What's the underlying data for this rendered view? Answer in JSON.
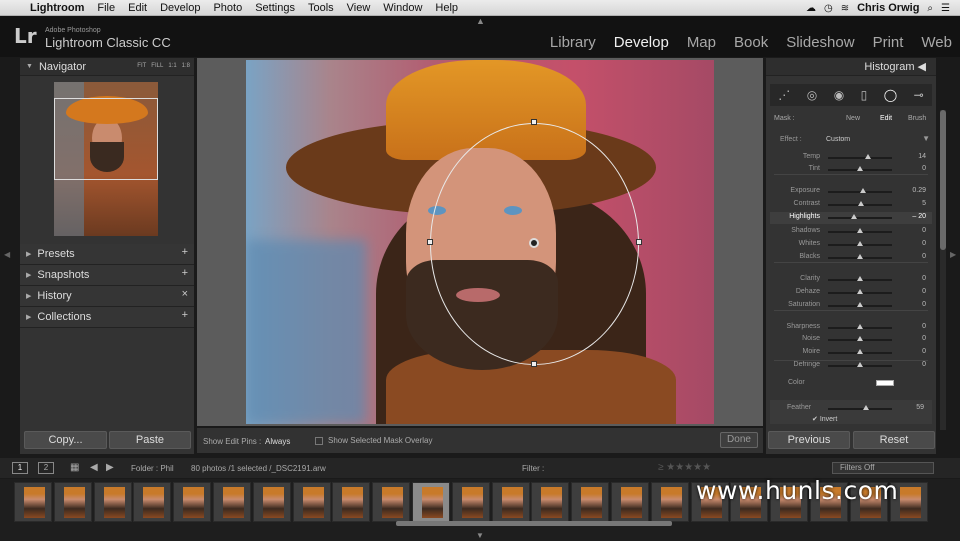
{
  "menubar": {
    "app": "Lightroom",
    "items": [
      "File",
      "Edit",
      "Develop",
      "Photo",
      "Settings",
      "Tools",
      "View",
      "Window",
      "Help"
    ],
    "user": "Chris Orwig"
  },
  "identity": {
    "logo": "Lr",
    "line1": "Adobe Photoshop",
    "line2": "Lightroom Classic CC"
  },
  "modules": {
    "library": "Library",
    "develop": "Develop",
    "map": "Map",
    "book": "Book",
    "slideshow": "Slideshow",
    "print": "Print",
    "web": "Web",
    "active": "Develop"
  },
  "left_panel": {
    "navigator": "Navigator",
    "zoom": {
      "fit": "FIT",
      "fill": "FILL",
      "one": "1:1",
      "ratio": "1:8"
    },
    "sections": [
      {
        "label": "Presets",
        "action": "+"
      },
      {
        "label": "Snapshots",
        "action": "+"
      },
      {
        "label": "History",
        "action": "×"
      },
      {
        "label": "Collections",
        "action": "+"
      }
    ],
    "copy": "Copy...",
    "paste": "Paste"
  },
  "toolbar": {
    "pins_label": "Show Edit Pins :",
    "pins_value": "Always",
    "overlay_label": "Show Selected Mask Overlay",
    "done": "Done"
  },
  "right_panel": {
    "histogram": "Histogram",
    "mask": {
      "label": "Mask :",
      "new": "New",
      "edit": "Edit",
      "brush": "Brush"
    },
    "effect": {
      "label": "Effect :",
      "value": "Custom"
    },
    "sliders": [
      {
        "name": "Temp",
        "value": "14",
        "pos": 0.62
      },
      {
        "name": "Tint",
        "value": "0",
        "pos": 0.5
      },
      {
        "name": "Exposure",
        "value": "0.29",
        "pos": 0.55
      },
      {
        "name": "Contrast",
        "value": "5",
        "pos": 0.52
      },
      {
        "name": "Highlights",
        "value": "– 20",
        "pos": 0.4,
        "active": true
      },
      {
        "name": "Shadows",
        "value": "0",
        "pos": 0.5
      },
      {
        "name": "Whites",
        "value": "0",
        "pos": 0.5
      },
      {
        "name": "Blacks",
        "value": "0",
        "pos": 0.5
      },
      {
        "name": "Clarity",
        "value": "0",
        "pos": 0.5
      },
      {
        "name": "Dehaze",
        "value": "0",
        "pos": 0.5
      },
      {
        "name": "Saturation",
        "value": "0",
        "pos": 0.5
      },
      {
        "name": "Sharpness",
        "value": "0",
        "pos": 0.5
      },
      {
        "name": "Noise",
        "value": "0",
        "pos": 0.5
      },
      {
        "name": "Moire",
        "value": "0",
        "pos": 0.5
      },
      {
        "name": "Defringe",
        "value": "0",
        "pos": 0.5
      }
    ],
    "color_label": "Color",
    "feather": {
      "label": "Feather",
      "value": "59",
      "pos": 0.59
    },
    "invert": "Invert",
    "previous": "Previous",
    "reset": "Reset"
  },
  "filmstrip": {
    "page1": "1",
    "page2": "2",
    "folder": "Folder : Phil",
    "count": "80 photos /1 selected /_DSC2191.arw",
    "filter_label": "Filter :",
    "filters_off": "Filters Off",
    "selected_index": 10,
    "thumb_count": 23
  },
  "watermark": "www.hunls.com",
  "colors": {
    "panel": "#333333",
    "accent": "#f0f0f0",
    "hat": "#d4781e"
  }
}
